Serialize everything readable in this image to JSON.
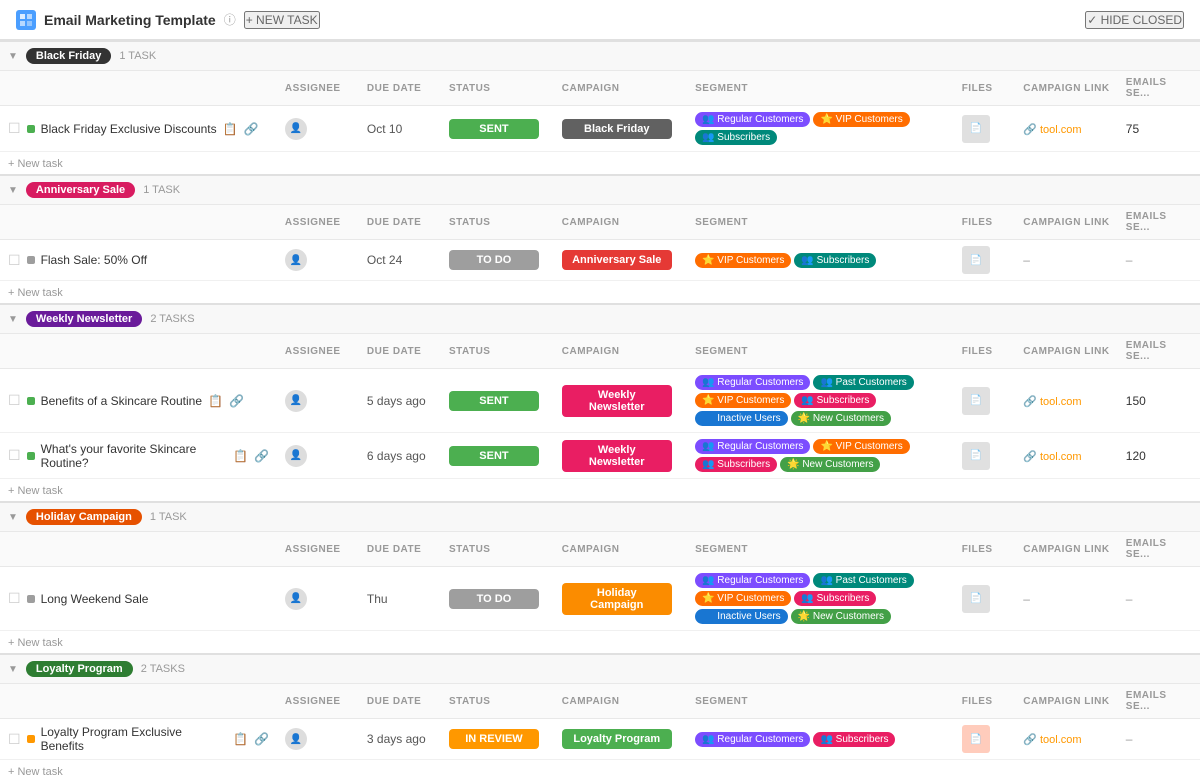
{
  "header": {
    "icon_color": "#4a9eff",
    "title": "Email Marketing Template",
    "new_task_label": "+ NEW TASK",
    "hide_closed_label": "✓ HIDE CLOSED"
  },
  "columns": [
    {
      "key": "task",
      "label": ""
    },
    {
      "key": "assignee",
      "label": "ASSIGNEE"
    },
    {
      "key": "duedate",
      "label": "DUE DATE"
    },
    {
      "key": "status",
      "label": "STATUS"
    },
    {
      "key": "campaign",
      "label": "CAMPAIGN"
    },
    {
      "key": "segment",
      "label": "SEGMENT"
    },
    {
      "key": "files",
      "label": "FILES"
    },
    {
      "key": "campaignlink",
      "label": "CAMPAIGN LINK"
    },
    {
      "key": "emails",
      "label": "EMAILS SE..."
    }
  ],
  "groups": [
    {
      "id": "black-friday",
      "label": "Black Friday",
      "color": "#333333",
      "bg_color": "#333333",
      "task_count": "1 TASK",
      "tasks": [
        {
          "id": "bf1",
          "name": "Black Friday Exclusive Discounts",
          "dot_color": "#4caf50",
          "has_icons": true,
          "assignee": "",
          "due_date": "Oct 10",
          "status": "SENT",
          "status_type": "sent",
          "campaign": "Black Friday",
          "campaign_color": "#616161",
          "segments": [
            {
              "label": "Regular Customers",
              "class": "seg-purple",
              "icon": "👥"
            },
            {
              "label": "VIP Customers",
              "class": "seg-orange",
              "icon": "⭐"
            },
            {
              "label": "Subscribers",
              "class": "seg-teal",
              "icon": "👥"
            }
          ],
          "files": "📄",
          "campaign_link": "tool.com",
          "emails_count": "75"
        }
      ]
    },
    {
      "id": "anniversary-sale",
      "label": "Anniversary Sale",
      "color": "#d81b60",
      "bg_color": "#d81b60",
      "task_count": "1 TASK",
      "tasks": [
        {
          "id": "as1",
          "name": "Flash Sale: 50% Off",
          "dot_color": "#9e9e9e",
          "has_icons": false,
          "assignee": "",
          "due_date": "Oct 24",
          "status": "TO DO",
          "status_type": "todo",
          "campaign": "Anniversary Sale",
          "campaign_color": "#e53935",
          "segments": [
            {
              "label": "VIP Customers",
              "class": "seg-orange",
              "icon": "⭐"
            },
            {
              "label": "Subscribers",
              "class": "seg-teal",
              "icon": "👥"
            }
          ],
          "files": "📄",
          "campaign_link": "–",
          "emails_count": "–"
        }
      ]
    },
    {
      "id": "weekly-newsletter",
      "label": "Weekly Newsletter",
      "color": "#6a1b9a",
      "bg_color": "#6a1b9a",
      "task_count": "2 TASKS",
      "tasks": [
        {
          "id": "wn1",
          "name": "Benefits of a Skincare Routine",
          "dot_color": "#4caf50",
          "has_icons": true,
          "assignee": "",
          "due_date": "5 days ago",
          "status": "SENT",
          "status_type": "sent",
          "campaign": "Weekly Newsletter",
          "campaign_color": "#e91e63",
          "segments": [
            {
              "label": "Regular Customers",
              "class": "seg-purple",
              "icon": "👥"
            },
            {
              "label": "Past Customers",
              "class": "seg-teal",
              "icon": "👥"
            },
            {
              "label": "VIP Customers",
              "class": "seg-orange",
              "icon": "⭐"
            },
            {
              "label": "Subscribers",
              "class": "seg-pink",
              "icon": "👥"
            },
            {
              "label": "Inactive Users",
              "class": "seg-blue",
              "icon": "👤"
            },
            {
              "label": "New Customers",
              "class": "seg-green",
              "icon": "🌟"
            }
          ],
          "files": "📄",
          "campaign_link": "tool.com",
          "emails_count": "150"
        },
        {
          "id": "wn2",
          "name": "What's your favorite Skincare Routine?",
          "dot_color": "#4caf50",
          "has_icons": true,
          "assignee": "",
          "due_date": "6 days ago",
          "status": "SENT",
          "status_type": "sent",
          "campaign": "Weekly Newsletter",
          "campaign_color": "#e91e63",
          "segments": [
            {
              "label": "Regular Customers",
              "class": "seg-purple",
              "icon": "👥"
            },
            {
              "label": "VIP Customers",
              "class": "seg-orange",
              "icon": "⭐"
            },
            {
              "label": "Subscribers",
              "class": "seg-pink",
              "icon": "👥"
            },
            {
              "label": "New Customers",
              "class": "seg-green",
              "icon": "🌟"
            }
          ],
          "files": "📄",
          "campaign_link": "tool.com",
          "emails_count": "120"
        }
      ]
    },
    {
      "id": "holiday-campaign",
      "label": "Holiday Campaign",
      "color": "#e65100",
      "bg_color": "#e65100",
      "task_count": "1 TASK",
      "tasks": [
        {
          "id": "hc1",
          "name": "Long Weekend Sale",
          "dot_color": "#9e9e9e",
          "has_icons": false,
          "assignee": "",
          "due_date": "Thu",
          "status": "TO DO",
          "status_type": "todo",
          "campaign": "Holiday Campaign",
          "campaign_color": "#fb8c00",
          "segments": [
            {
              "label": "Regular Customers",
              "class": "seg-purple",
              "icon": "👥"
            },
            {
              "label": "Past Customers",
              "class": "seg-teal",
              "icon": "👥"
            },
            {
              "label": "VIP Customers",
              "class": "seg-orange",
              "icon": "⭐"
            },
            {
              "label": "Subscribers",
              "class": "seg-pink",
              "icon": "👥"
            },
            {
              "label": "Inactive Users",
              "class": "seg-blue",
              "icon": "👤"
            },
            {
              "label": "New Customers",
              "class": "seg-green",
              "icon": "🌟"
            }
          ],
          "files": "📄",
          "campaign_link": "–",
          "emails_count": "–"
        }
      ]
    },
    {
      "id": "loyalty-program",
      "label": "Loyalty Program",
      "color": "#2e7d32",
      "bg_color": "#2e7d32",
      "task_count": "2 TASKS",
      "tasks": [
        {
          "id": "lp1",
          "name": "Loyalty Program Exclusive Benefits",
          "dot_color": "#ff9800",
          "has_icons": true,
          "assignee": "",
          "due_date": "3 days ago",
          "status": "IN REVIEW",
          "status_type": "inreview",
          "campaign": "Loyalty Program",
          "campaign_color": "#4caf50",
          "segments": [
            {
              "label": "Regular Customers",
              "class": "seg-purple",
              "icon": "👥"
            },
            {
              "label": "Subscribers",
              "class": "seg-pink",
              "icon": "👥"
            }
          ],
          "files": "📄",
          "campaign_link": "tool.com",
          "emails_count": ""
        }
      ]
    }
  ]
}
